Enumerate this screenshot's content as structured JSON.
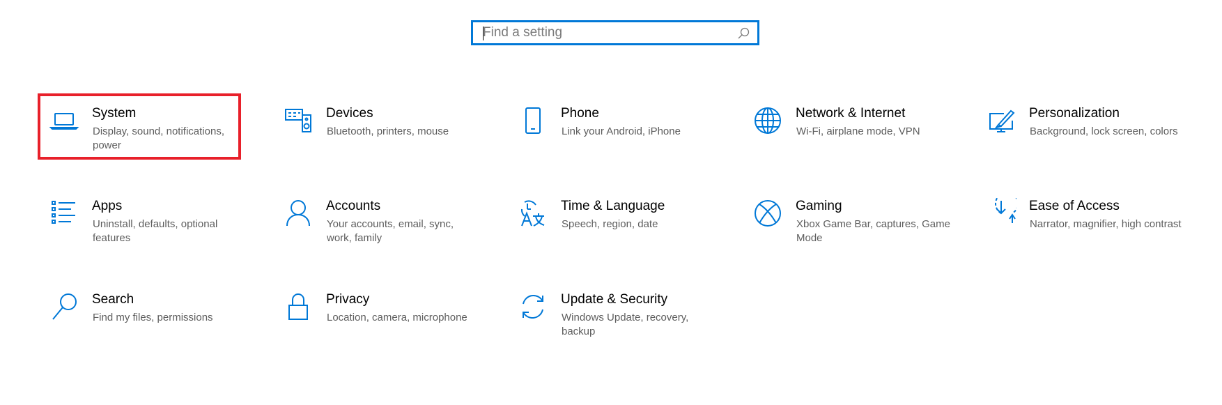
{
  "search": {
    "placeholder": "Find a setting",
    "value": ""
  },
  "accent_color": "#0078d7",
  "highlight_color": "#e8202a",
  "tiles": [
    {
      "title": "System",
      "description": "Display, sound, notifications, power",
      "icon": "laptop-icon",
      "highlighted": true
    },
    {
      "title": "Devices",
      "description": "Bluetooth, printers, mouse",
      "icon": "devices-icon"
    },
    {
      "title": "Phone",
      "description": "Link your Android, iPhone",
      "icon": "phone-icon"
    },
    {
      "title": "Network & Internet",
      "description": "Wi-Fi, airplane mode, VPN",
      "icon": "globe-icon"
    },
    {
      "title": "Personalization",
      "description": "Background, lock screen, colors",
      "icon": "paintbrush-icon"
    },
    {
      "title": "Apps",
      "description": "Uninstall, defaults, optional features",
      "icon": "apps-list-icon"
    },
    {
      "title": "Accounts",
      "description": "Your accounts, email, sync, work, family",
      "icon": "person-icon"
    },
    {
      "title": "Time & Language",
      "description": "Speech, region, date",
      "icon": "time-language-icon"
    },
    {
      "title": "Gaming",
      "description": "Xbox Game Bar, captures, Game Mode",
      "icon": "xbox-icon"
    },
    {
      "title": "Ease of Access",
      "description": "Narrator, magnifier, high contrast",
      "icon": "ease-of-access-icon"
    },
    {
      "title": "Search",
      "description": "Find my files, permissions",
      "icon": "search-magnifier-icon"
    },
    {
      "title": "Privacy",
      "description": "Location, camera, microphone",
      "icon": "lock-icon"
    },
    {
      "title": "Update & Security",
      "description": "Windows Update, recovery, backup",
      "icon": "sync-icon"
    }
  ]
}
